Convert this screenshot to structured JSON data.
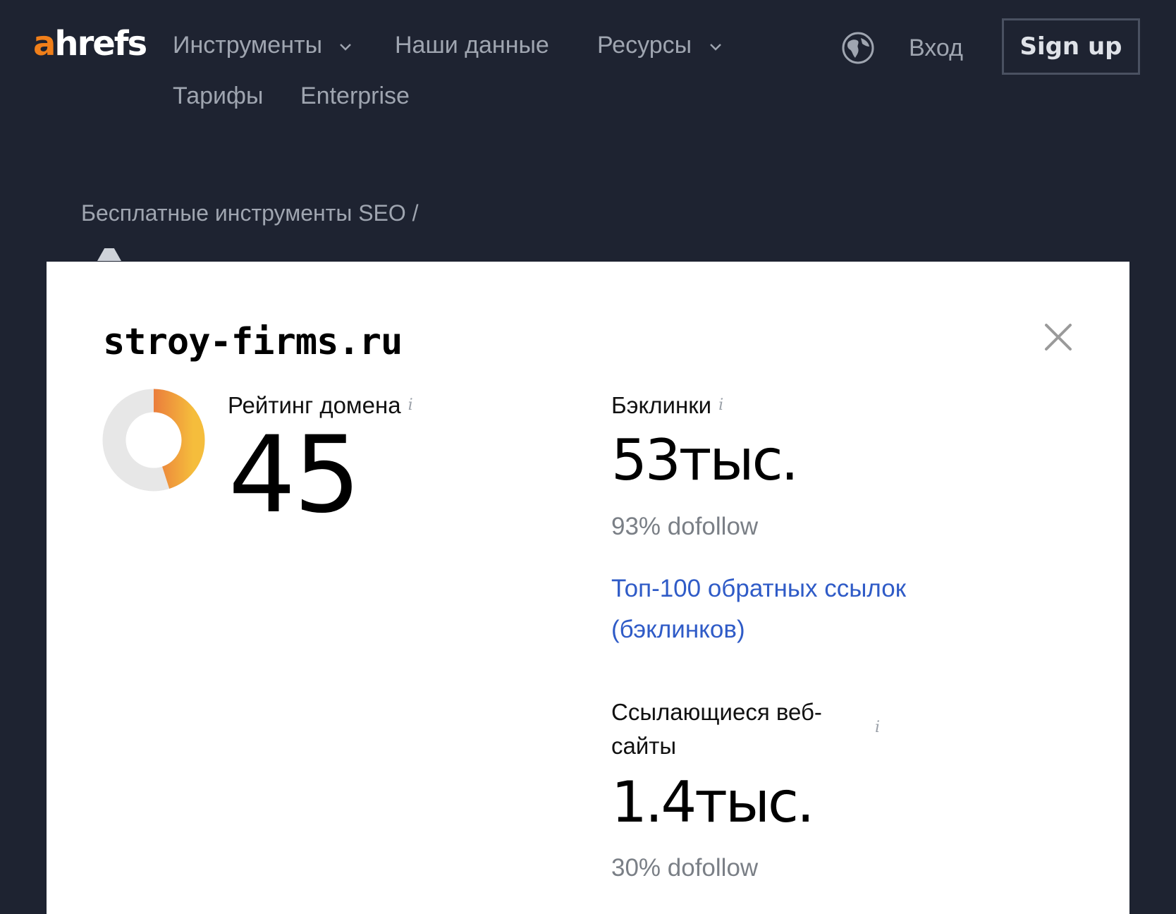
{
  "header": {
    "logo_a": "a",
    "logo_rest": "hrefs",
    "nav": {
      "tools": "Инструменты",
      "data": "Наши данные",
      "resources": "Ресурсы",
      "pricing": "Тарифы",
      "enterprise": "Enterprise"
    },
    "login": "Вход",
    "signup": "Sign up"
  },
  "breadcrumb": "Бесплатные инструменты SEO /",
  "modal": {
    "domain": "stroy-firms.ru",
    "domain_rating": {
      "label": "Рейтинг домена",
      "value": "45",
      "level_percent": 45
    },
    "backlinks": {
      "label": "Бэклинки",
      "value": "53тыс.",
      "dofollow": "93% dofollow",
      "link": "Топ-100 обратных ссылок (бэклинков)"
    },
    "referring": {
      "label_line1": "Ссылающиеся веб-",
      "label_line2": "сайты",
      "value": "1.4тыс.",
      "dofollow": "30% dofollow"
    },
    "info_glyph": "i"
  },
  "colors": {
    "header_bg": "#1e2331",
    "logo_accent": "#f07f1a",
    "link": "#2f5bc7",
    "donut_start": "#e03d3d",
    "donut_end": "#f5bd3c",
    "donut_track": "#e7e7e7"
  },
  "icons": [
    "chevron-down-icon",
    "globe-icon",
    "close-icon",
    "info-icon"
  ]
}
